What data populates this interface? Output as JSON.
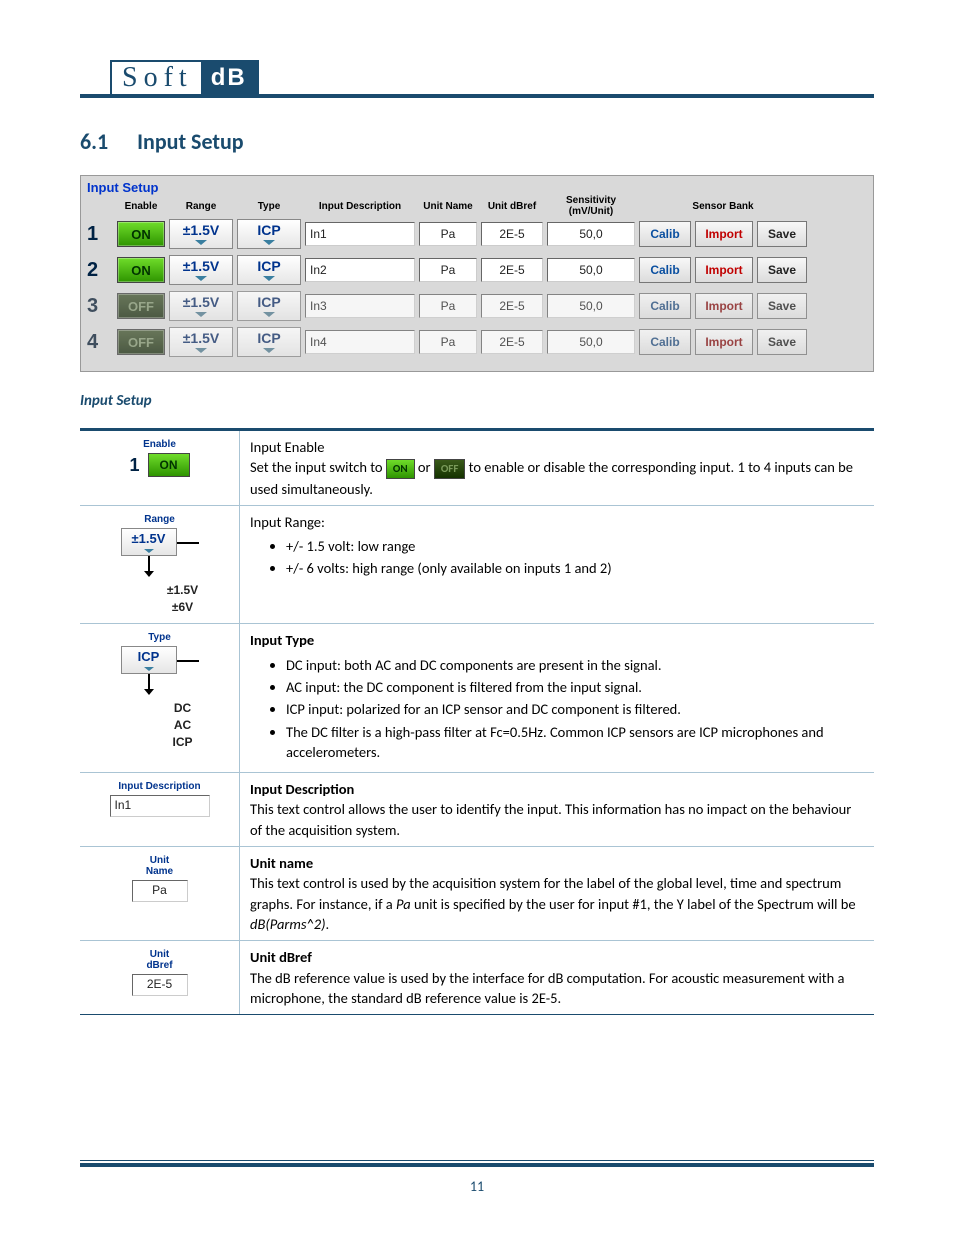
{
  "logo": {
    "left": "Soft",
    "right": "dB"
  },
  "section": {
    "number": "6.1",
    "title": "Input Setup"
  },
  "panel": {
    "title": "Input Setup",
    "headers": {
      "enable": "Enable",
      "range": "Range",
      "type": "Type",
      "desc": "Input Description",
      "unitName": "Unit Name",
      "unitDbref": "Unit dBref",
      "sens": "Sensitivity (mV/Unit)",
      "bank": "Sensor Bank"
    },
    "rows": [
      {
        "ch": "1",
        "enable": "ON",
        "on": true,
        "range": "±1.5V",
        "type": "ICP",
        "desc": "In1",
        "unitName": "Pa",
        "dbref": "2E-5",
        "sens": "50,0",
        "calib": "Calib",
        "import": "Import",
        "save": "Save"
      },
      {
        "ch": "2",
        "enable": "ON",
        "on": true,
        "range": "±1.5V",
        "type": "ICP",
        "desc": "In2",
        "unitName": "Pa",
        "dbref": "2E-5",
        "sens": "50,0",
        "calib": "Calib",
        "import": "Import",
        "save": "Save"
      },
      {
        "ch": "3",
        "enable": "OFF",
        "on": false,
        "range": "±1.5V",
        "type": "ICP",
        "desc": "In3",
        "unitName": "Pa",
        "dbref": "2E-5",
        "sens": "50,0",
        "calib": "Calib",
        "import": "Import",
        "save": "Save"
      },
      {
        "ch": "4",
        "enable": "OFF",
        "on": false,
        "range": "±1.5V",
        "type": "ICP",
        "desc": "In4",
        "unitName": "Pa",
        "dbref": "2E-5",
        "sens": "50,0",
        "calib": "Calib",
        "import": "Import",
        "save": "Save"
      }
    ]
  },
  "descTable": {
    "caption": "Input Setup",
    "rows": [
      {
        "miniLabel": "Enable",
        "miniCh": "1",
        "miniText": "ON",
        "rightTitle": "Input Enable",
        "rightBody1": "Set the input switch to ",
        "toggleOn": "ON",
        "rightBody2": " or ",
        "toggleOff": "OFF",
        "rightBody3": " to enable or disable the corresponding input. 1 to 4 inputs can be used simultaneously."
      },
      {
        "miniLabel": "Range",
        "miniDD": "±1.5V",
        "options": [
          "±1.5V",
          "±6V"
        ],
        "rightTitle": "Input Range:",
        "bullets": [
          "+/- 1.5 volt: low range",
          "+/- 6 volts: high range (only available on inputs 1 and 2)"
        ]
      },
      {
        "miniLabel": "Type",
        "miniDD": "ICP",
        "options": [
          "DC",
          "AC",
          "ICP"
        ],
        "rightTitle": "Input Type",
        "bullets": [
          "DC input: both AC and DC components are present in the signal.",
          "AC input: the DC component is filtered from the input signal.",
          "ICP input: polarized for an ICP sensor and DC component is filtered.",
          "The DC filter is a high-pass filter at Fc=0.5Hz. Common ICP sensors are ICP microphones and accelerometers."
        ]
      },
      {
        "miniLabel": "Input Description",
        "miniField": "In1",
        "rightTitle": "Input Description",
        "rightText": "This text control allows the user to identify the input. This information has no impact on the behaviour of the acquisition system."
      },
      {
        "miniLabel": "Unit Name",
        "miniField": "Pa",
        "center": true,
        "rightTitle": "Unit name",
        "rightHtml": "This text control is used by the acquisition system for the label of the global level, time and spectrum graphs. For instance, if a <i>Pa</i> unit is specified by the user for input #1, the Y label of the Spectrum will be <i>dB(Parms^2)</i>."
      },
      {
        "miniLabel": "Unit dBref",
        "miniField": "2E-5",
        "center": true,
        "rightTitle": "Unit dBref",
        "rightText": "The dB reference value is used by the interface for dB computation. For acoustic measurement with a microphone, the standard dB reference value is 2E-5."
      }
    ]
  },
  "pageNumber": "11"
}
